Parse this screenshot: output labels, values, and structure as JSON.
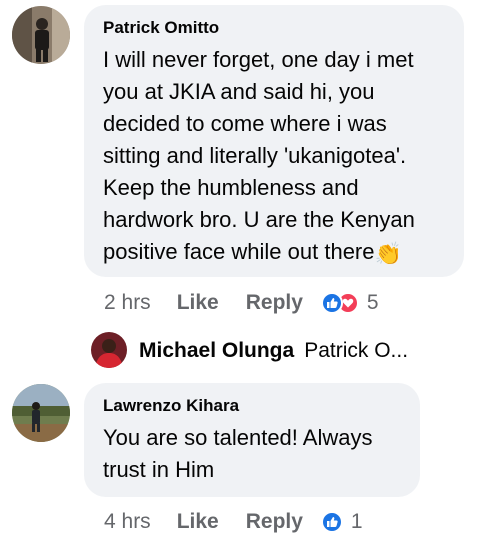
{
  "comments": [
    {
      "author": "Patrick Omitto",
      "text_lines": [
        "I will never forget, one day i met",
        "you at JKIA and said hi, you",
        "decided to come where i was",
        "sitting and literally 'ukanigotea'.",
        "Keep the humbleness and",
        "hardwork bro. U are the Kenyan",
        "positive face while out there"
      ],
      "emoji": "👏",
      "time": "2 hrs",
      "like_label": "Like",
      "reply_label": "Reply",
      "reaction_count": "5",
      "reply_preview": {
        "name": "Michael Olunga",
        "text": "Patrick O..."
      }
    },
    {
      "author": "Lawrenzo Kihara",
      "text_lines": [
        "You are so talented! Always",
        "trust in Him"
      ],
      "time": "4 hrs",
      "like_label": "Like",
      "reply_label": "Reply",
      "reaction_count": "1"
    }
  ],
  "colors": {
    "bubble": "#f0f2f5",
    "meta_text": "#65676b",
    "like_blue": "#1b74e4",
    "love_red": "#f33e58"
  }
}
